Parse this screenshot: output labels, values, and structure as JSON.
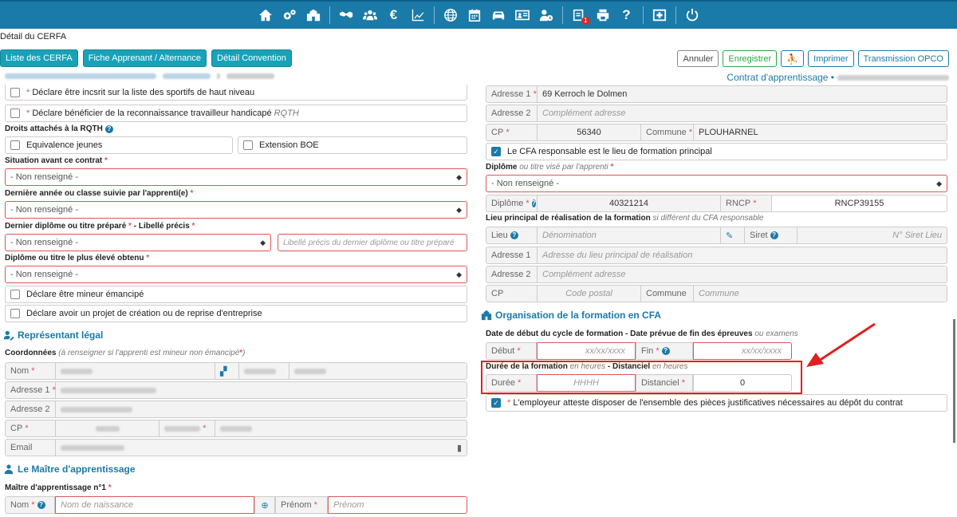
{
  "page": {
    "title": "Détail du CERFA"
  },
  "tabs": [
    {
      "label": "Liste des CERFA"
    },
    {
      "label": "Fiche Apprenant / Alternance"
    },
    {
      "label": "Détail Convention"
    }
  ],
  "actions": {
    "annuler": "Annuler",
    "enregistrer": "Enregistrer",
    "imprimer": "Imprimer",
    "transmission": "Transmission OPCO"
  },
  "header": {
    "contrat": "Contrat d'apprentissage •"
  },
  "topbar": {
    "euro": "€",
    "help": "?",
    "badge": "1"
  },
  "left": {
    "sportifs": "Déclare être incsrit sur la liste des sportifs de haut niveau",
    "rqth": "Déclare bénéficier de la reconnaissance travailleur handicapé",
    "rqth_abbr": "RQTH",
    "droits_label": "Droits attachés à la RQTH",
    "equivalence": "Equivalence jeunes",
    "boe": "Extension BOE",
    "situation_label": "Situation avant ce contrat",
    "not_set": "- Non renseigné -",
    "derniere_annee_label": "Dernière année ou classe suivie par l'apprenti(e)",
    "dernier_diplome_label": "Dernier diplôme ou titre préparé",
    "libelle_label": "Libellé précis",
    "libelle_ph": "Libellé précis du dernier diplôme ou titre préparé",
    "diplome_eleve_label": "Diplôme ou titre le plus élevé obtenu",
    "mineur": "Déclare être mineur émancipé",
    "projet": "Déclare avoir un projet de création ou de reprise d'entreprise",
    "rep_title": "Représentant légal",
    "coord_label": "Coordonnées",
    "coord_note": "(à renseigner si l'apprenti est mineur non émancipé",
    "nom": "Nom",
    "adresse1": "Adresse 1",
    "adresse2": "Adresse 2",
    "cp": "CP",
    "email": "Email",
    "commune": "Commune",
    "maitre_title": "Le Maître d'apprentissage",
    "maitre_label": "Maître d'apprentissage n°1",
    "nom_ph": "Nom de naissance",
    "prenom": "Prénom",
    "prenom_ph": "Prénom"
  },
  "right": {
    "adresse1": "Adresse 1",
    "adresse1_val": "69 Kerroch le Dolmen",
    "adresse2": "Adresse 2",
    "adresse2_ph": "Complément adresse",
    "cp": "CP",
    "cp_val": "56340",
    "commune": "Commune",
    "commune_val": "PLOUHARNEL",
    "cfa_resp": "Le CFA responsable est le lieu de formation principal",
    "diplome_label": "Diplôme",
    "diplome_note": "ou titre visé par l'apprenti",
    "not_set": "- Non renseigné -",
    "diplome": "Diplôme",
    "diplome_val": "40321214",
    "rncp": "RNCP",
    "rncp_val": "RNCP39155",
    "lieu_label": "Lieu principal de réalisation de la formation",
    "lieu_note": "si différent du CFA responsable",
    "lieu": "Lieu",
    "lieu_ph": "Dénomination",
    "siret": "Siret",
    "siret_ph": "N° Siret Lieu",
    "adr_ph": "Adresse du lieu principal de réalisation",
    "cp_ph": "Code postal",
    "commune_ph": "Commune",
    "org_title": "Organisation de la formation en CFA",
    "dates_label": "Date de début du cycle de formation - Date prévue de fin des épreuves",
    "dates_note": "ou examens",
    "debut": "Début",
    "fin": "Fin",
    "date_ph": "xx/xx/xxxx",
    "duree_label": "Durée de la formation",
    "duree_note": "en heures",
    "distanciel_label": "Distanciel",
    "duree": "Durée",
    "duree_ph": "HHHH",
    "distanciel": "Distanciel",
    "distanciel_val": "0",
    "employeur": "L'employeur atteste disposer de l'ensemble des pièces justificatives nécessaires au dépôt du contrat"
  },
  "colors": {
    "accent": "#1a7aa8",
    "tab": "#17a2b8",
    "required": "#d9534f",
    "highlight": "#e02020"
  }
}
